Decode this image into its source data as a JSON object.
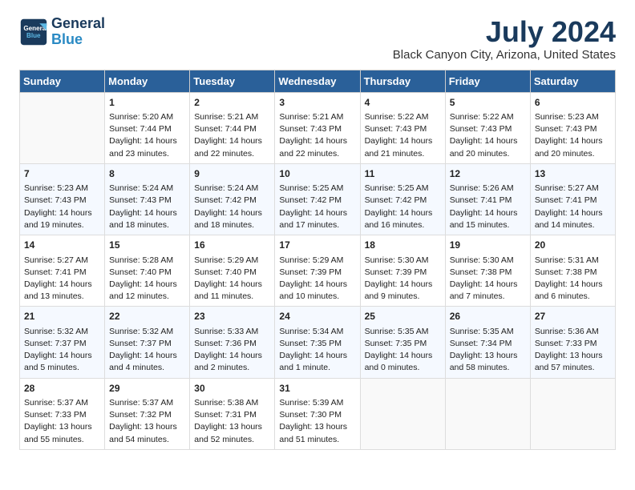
{
  "header": {
    "logo_line1": "General",
    "logo_line2": "Blue",
    "month_year": "July 2024",
    "location": "Black Canyon City, Arizona, United States"
  },
  "days_of_week": [
    "Sunday",
    "Monday",
    "Tuesday",
    "Wednesday",
    "Thursday",
    "Friday",
    "Saturday"
  ],
  "weeks": [
    [
      {
        "day": "",
        "info": ""
      },
      {
        "day": "1",
        "info": "Sunrise: 5:20 AM\nSunset: 7:44 PM\nDaylight: 14 hours\nand 23 minutes."
      },
      {
        "day": "2",
        "info": "Sunrise: 5:21 AM\nSunset: 7:44 PM\nDaylight: 14 hours\nand 22 minutes."
      },
      {
        "day": "3",
        "info": "Sunrise: 5:21 AM\nSunset: 7:43 PM\nDaylight: 14 hours\nand 22 minutes."
      },
      {
        "day": "4",
        "info": "Sunrise: 5:22 AM\nSunset: 7:43 PM\nDaylight: 14 hours\nand 21 minutes."
      },
      {
        "day": "5",
        "info": "Sunrise: 5:22 AM\nSunset: 7:43 PM\nDaylight: 14 hours\nand 20 minutes."
      },
      {
        "day": "6",
        "info": "Sunrise: 5:23 AM\nSunset: 7:43 PM\nDaylight: 14 hours\nand 20 minutes."
      }
    ],
    [
      {
        "day": "7",
        "info": "Sunrise: 5:23 AM\nSunset: 7:43 PM\nDaylight: 14 hours\nand 19 minutes."
      },
      {
        "day": "8",
        "info": "Sunrise: 5:24 AM\nSunset: 7:43 PM\nDaylight: 14 hours\nand 18 minutes."
      },
      {
        "day": "9",
        "info": "Sunrise: 5:24 AM\nSunset: 7:42 PM\nDaylight: 14 hours\nand 18 minutes."
      },
      {
        "day": "10",
        "info": "Sunrise: 5:25 AM\nSunset: 7:42 PM\nDaylight: 14 hours\nand 17 minutes."
      },
      {
        "day": "11",
        "info": "Sunrise: 5:25 AM\nSunset: 7:42 PM\nDaylight: 14 hours\nand 16 minutes."
      },
      {
        "day": "12",
        "info": "Sunrise: 5:26 AM\nSunset: 7:41 PM\nDaylight: 14 hours\nand 15 minutes."
      },
      {
        "day": "13",
        "info": "Sunrise: 5:27 AM\nSunset: 7:41 PM\nDaylight: 14 hours\nand 14 minutes."
      }
    ],
    [
      {
        "day": "14",
        "info": "Sunrise: 5:27 AM\nSunset: 7:41 PM\nDaylight: 14 hours\nand 13 minutes."
      },
      {
        "day": "15",
        "info": "Sunrise: 5:28 AM\nSunset: 7:40 PM\nDaylight: 14 hours\nand 12 minutes."
      },
      {
        "day": "16",
        "info": "Sunrise: 5:29 AM\nSunset: 7:40 PM\nDaylight: 14 hours\nand 11 minutes."
      },
      {
        "day": "17",
        "info": "Sunrise: 5:29 AM\nSunset: 7:39 PM\nDaylight: 14 hours\nand 10 minutes."
      },
      {
        "day": "18",
        "info": "Sunrise: 5:30 AM\nSunset: 7:39 PM\nDaylight: 14 hours\nand 9 minutes."
      },
      {
        "day": "19",
        "info": "Sunrise: 5:30 AM\nSunset: 7:38 PM\nDaylight: 14 hours\nand 7 minutes."
      },
      {
        "day": "20",
        "info": "Sunrise: 5:31 AM\nSunset: 7:38 PM\nDaylight: 14 hours\nand 6 minutes."
      }
    ],
    [
      {
        "day": "21",
        "info": "Sunrise: 5:32 AM\nSunset: 7:37 PM\nDaylight: 14 hours\nand 5 minutes."
      },
      {
        "day": "22",
        "info": "Sunrise: 5:32 AM\nSunset: 7:37 PM\nDaylight: 14 hours\nand 4 minutes."
      },
      {
        "day": "23",
        "info": "Sunrise: 5:33 AM\nSunset: 7:36 PM\nDaylight: 14 hours\nand 2 minutes."
      },
      {
        "day": "24",
        "info": "Sunrise: 5:34 AM\nSunset: 7:35 PM\nDaylight: 14 hours\nand 1 minute."
      },
      {
        "day": "25",
        "info": "Sunrise: 5:35 AM\nSunset: 7:35 PM\nDaylight: 14 hours\nand 0 minutes."
      },
      {
        "day": "26",
        "info": "Sunrise: 5:35 AM\nSunset: 7:34 PM\nDaylight: 13 hours\nand 58 minutes."
      },
      {
        "day": "27",
        "info": "Sunrise: 5:36 AM\nSunset: 7:33 PM\nDaylight: 13 hours\nand 57 minutes."
      }
    ],
    [
      {
        "day": "28",
        "info": "Sunrise: 5:37 AM\nSunset: 7:33 PM\nDaylight: 13 hours\nand 55 minutes."
      },
      {
        "day": "29",
        "info": "Sunrise: 5:37 AM\nSunset: 7:32 PM\nDaylight: 13 hours\nand 54 minutes."
      },
      {
        "day": "30",
        "info": "Sunrise: 5:38 AM\nSunset: 7:31 PM\nDaylight: 13 hours\nand 52 minutes."
      },
      {
        "day": "31",
        "info": "Sunrise: 5:39 AM\nSunset: 7:30 PM\nDaylight: 13 hours\nand 51 minutes."
      },
      {
        "day": "",
        "info": ""
      },
      {
        "day": "",
        "info": ""
      },
      {
        "day": "",
        "info": ""
      }
    ]
  ]
}
